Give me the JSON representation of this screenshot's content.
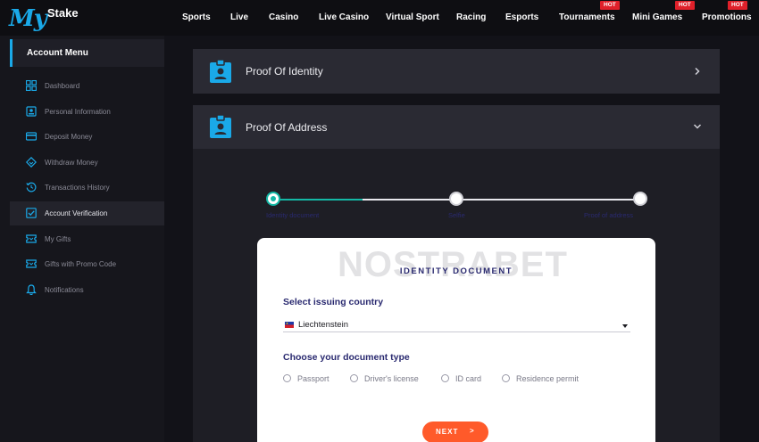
{
  "brand": {
    "logo_my": "My",
    "logo_stake": "Stake"
  },
  "nav": [
    {
      "label": "Sports"
    },
    {
      "label": "Live"
    },
    {
      "label": "Casino"
    },
    {
      "label": "Live Casino"
    },
    {
      "label": "Virtual Sport"
    },
    {
      "label": "Racing"
    },
    {
      "label": "Esports"
    },
    {
      "label": "Tournaments",
      "badge": "HOT"
    },
    {
      "label": "Mini Games",
      "badge": "HOT"
    },
    {
      "label": "Promotions",
      "badge": "HOT"
    }
  ],
  "sidebar": {
    "title": "Account Menu",
    "items": [
      {
        "label": "Dashboard",
        "icon": "dashboard-icon"
      },
      {
        "label": "Personal Information",
        "icon": "id-card-icon"
      },
      {
        "label": "Deposit Money",
        "icon": "credit-card-icon"
      },
      {
        "label": "Withdraw Money",
        "icon": "withdraw-icon"
      },
      {
        "label": "Transactions History",
        "icon": "history-icon"
      },
      {
        "label": "Account Verification",
        "icon": "check-box-icon",
        "active": true
      },
      {
        "label": "My Gifts",
        "icon": "ticket-icon"
      },
      {
        "label": "Gifts with Promo Code",
        "icon": "ticket-icon"
      },
      {
        "label": "Notifications",
        "icon": "bell-icon"
      }
    ]
  },
  "sections": {
    "identity": {
      "title": "Proof Of Identity"
    },
    "address": {
      "title": "Proof Of Address"
    }
  },
  "stepper": {
    "steps": [
      {
        "label": "Identity document",
        "state": "active"
      },
      {
        "label": "Selfie",
        "state": "pending"
      },
      {
        "label": "Proof of address",
        "state": "pending"
      }
    ]
  },
  "card": {
    "title": "IDENTITY DOCUMENT",
    "watermark": "NOSTRABET",
    "country_label": "Select issuing country",
    "country_value": "Liechtenstein",
    "doc_type_label": "Choose your document type",
    "doc_types": [
      "Passport",
      "Driver's license",
      "ID card",
      "Residence permit"
    ],
    "next_label": "NEXT",
    "next_chevron": ">"
  },
  "colors": {
    "accent": "#1aa9e8",
    "hot": "#e0202a",
    "step_active": "#14b8a6",
    "next_button": "#ff5a2a",
    "heading": "#2a2a70"
  }
}
